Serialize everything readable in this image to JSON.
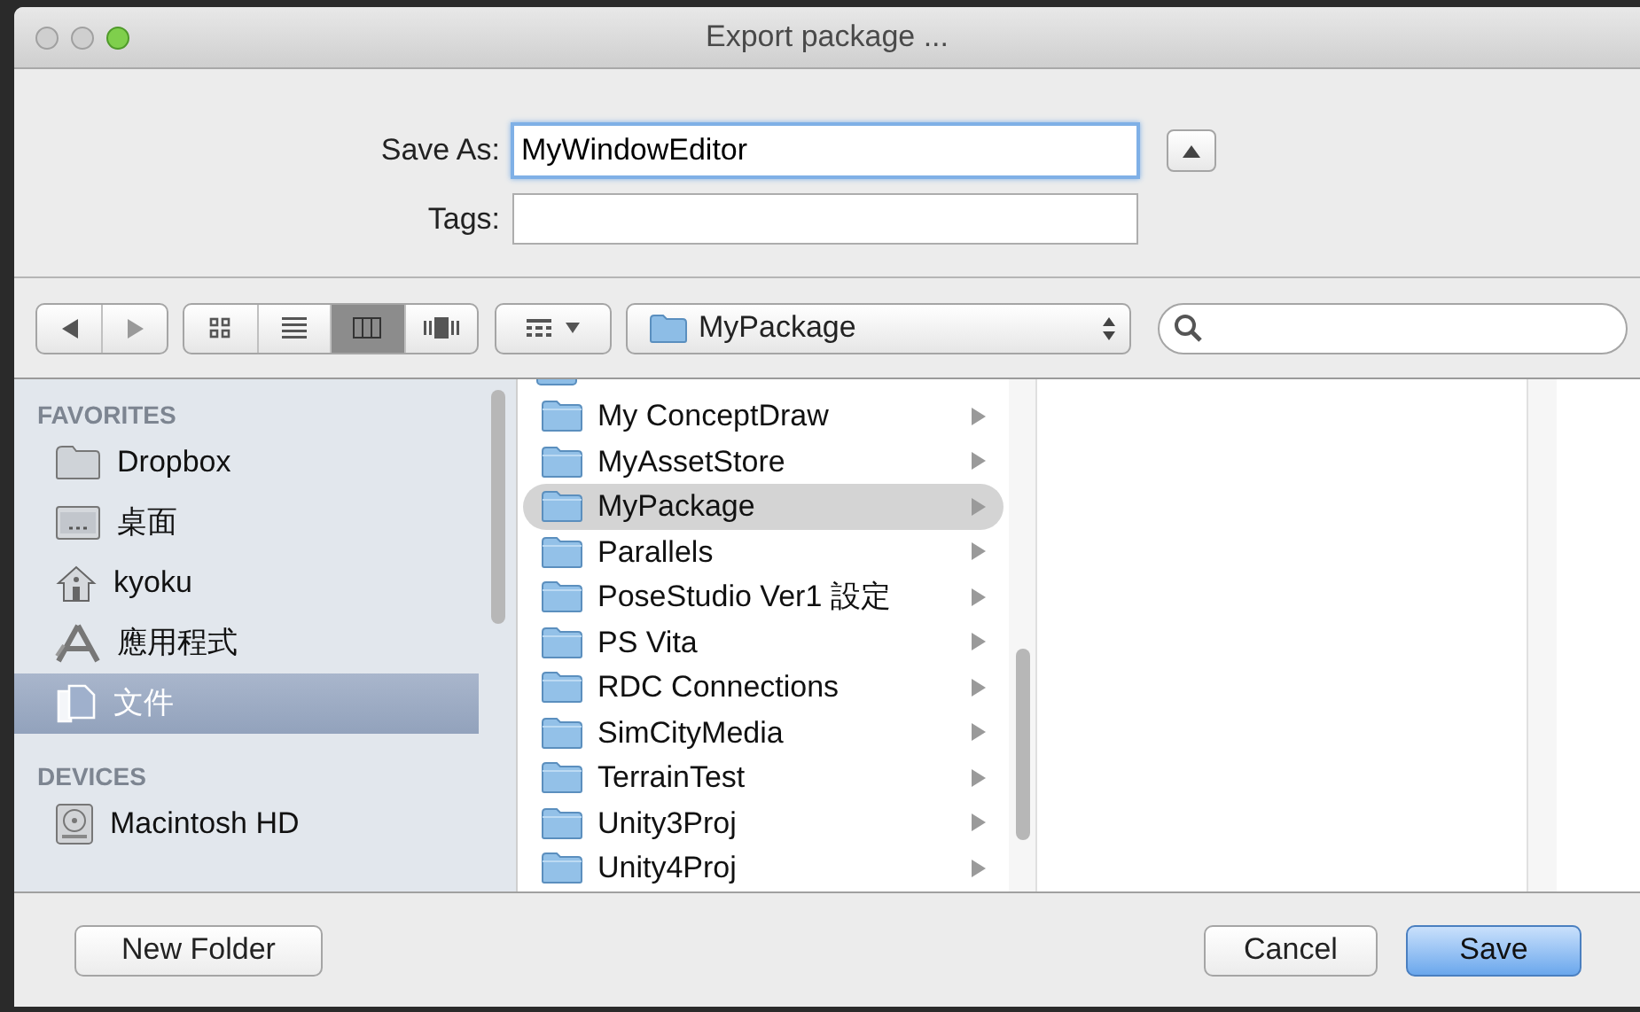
{
  "window": {
    "title": "Export package ..."
  },
  "save_as": {
    "label": "Save As:",
    "value": "MyWindowEditor"
  },
  "tags": {
    "label": "Tags:"
  },
  "view_modes": [
    {
      "kind": "icons",
      "selected": false
    },
    {
      "kind": "list",
      "selected": false
    },
    {
      "kind": "columns",
      "selected": true
    },
    {
      "kind": "coverflow",
      "selected": false
    }
  ],
  "location": {
    "value": "MyPackage"
  },
  "sidebar": [
    {
      "header": "FAVORITES",
      "items": [
        {
          "label": "Dropbox",
          "kind": "folder",
          "selected": false
        },
        {
          "label": "桌面",
          "kind": "desktop",
          "selected": false
        },
        {
          "label": "kyoku",
          "kind": "home",
          "selected": false
        },
        {
          "label": "應用程式",
          "kind": "apps",
          "selected": false
        },
        {
          "label": "文件",
          "kind": "documents",
          "selected": true
        }
      ]
    },
    {
      "header": "DEVICES",
      "items": [
        {
          "label": "Macintosh HD",
          "kind": "disk",
          "selected": false
        }
      ]
    }
  ],
  "column_1": [
    {
      "label": "My ConceptDraw",
      "selected": false
    },
    {
      "label": "MyAssetStore",
      "selected": false
    },
    {
      "label": "MyPackage",
      "selected": true
    },
    {
      "label": "Parallels",
      "selected": false
    },
    {
      "label": "PoseStudio Ver1 設定",
      "selected": false
    },
    {
      "label": "PS Vita",
      "selected": false
    },
    {
      "label": "RDC Connections",
      "selected": false
    },
    {
      "label": "SimCityMedia",
      "selected": false
    },
    {
      "label": "TerrainTest",
      "selected": false
    },
    {
      "label": "Unity3Proj",
      "selected": false
    },
    {
      "label": "Unity4Proj",
      "selected": false
    }
  ],
  "buttons": [
    {
      "label": "New Folder",
      "kind": "plain"
    },
    {
      "label": "Cancel",
      "kind": "plain"
    },
    {
      "label": "Save",
      "kind": "default"
    }
  ]
}
